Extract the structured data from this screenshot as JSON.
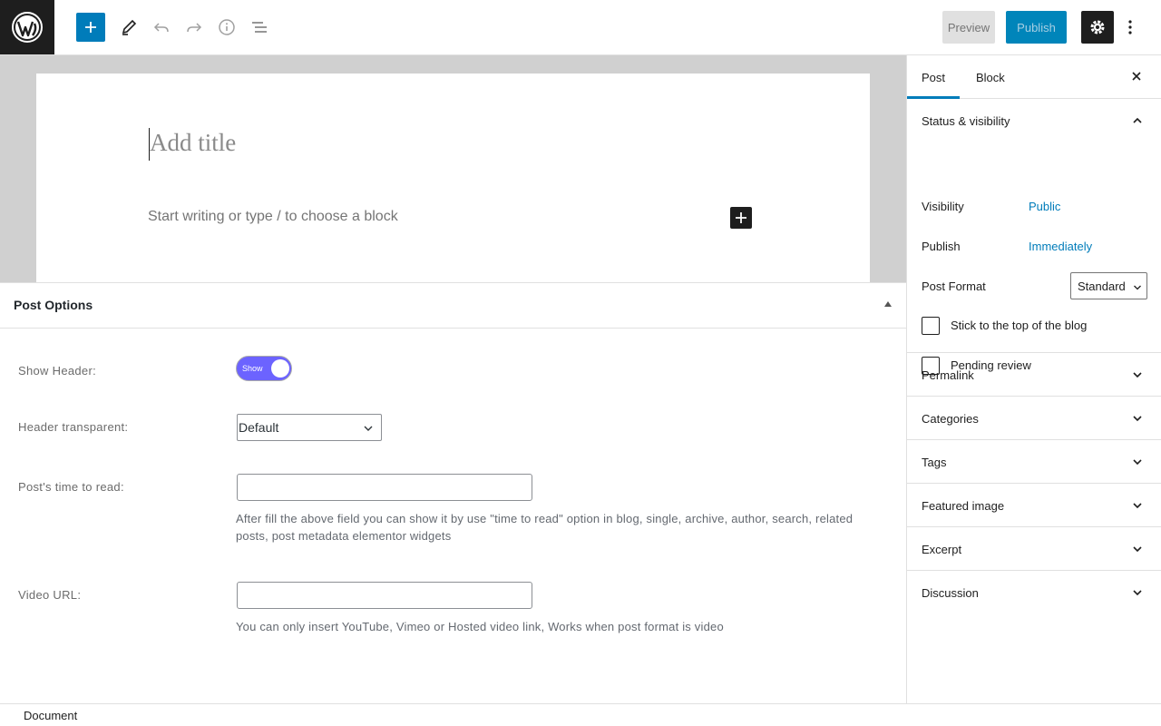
{
  "toolbar": {
    "preview_label": "Preview",
    "publish_label": "Publish"
  },
  "editor": {
    "title_placeholder": "Add title",
    "block_placeholder": "Start writing or type / to choose a block"
  },
  "post_options": {
    "title": "Post Options",
    "show_header_label": "Show Header:",
    "show_header_toggle": "Show",
    "header_transparent_label": "Header transparent:",
    "header_transparent_value": "Default",
    "time_to_read_label": "Post's time to read:",
    "time_to_read_help": "After fill the above field you can show it by use \"time to read\" option in blog, single, archive, author, search, related posts, post metadata elementor widgets",
    "video_url_label": "Video URL:",
    "video_url_help": "You can only insert YouTube, Vimeo or Hosted video link, Works when post format is video"
  },
  "sidebar": {
    "tabs": [
      {
        "label": "Post"
      },
      {
        "label": "Block"
      }
    ],
    "status": {
      "title": "Status & visibility",
      "visibility_label": "Visibility",
      "visibility_value": "Public",
      "publish_label": "Publish",
      "publish_value": "Immediately",
      "format_label": "Post Format",
      "format_value": "Standard",
      "stick_label": "Stick to the top of the blog",
      "pending_label": "Pending review"
    },
    "panels": [
      {
        "title": "Permalink"
      },
      {
        "title": "Categories"
      },
      {
        "title": "Tags"
      },
      {
        "title": "Featured image"
      },
      {
        "title": "Excerpt"
      },
      {
        "title": "Discussion"
      }
    ]
  },
  "footer": {
    "breadcrumb": "Document"
  },
  "colors": {
    "accent": "#007cba",
    "toggle": "#6c63ff",
    "dark": "#1e1e1e"
  }
}
